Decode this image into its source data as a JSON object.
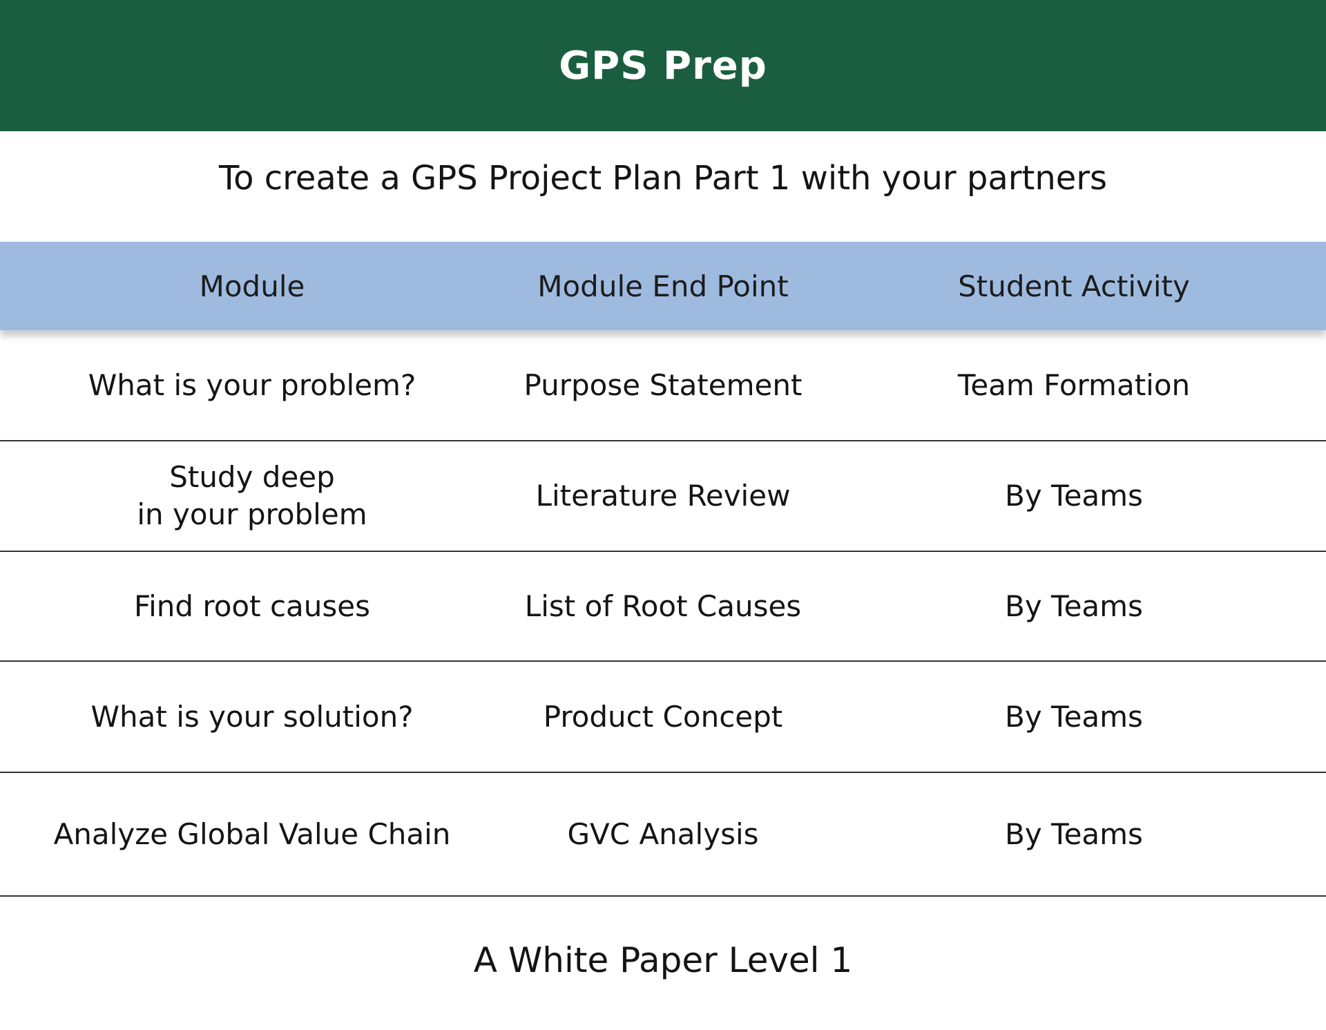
{
  "header": {
    "title": "GPS Prep",
    "color": "#1b5e3f"
  },
  "subtitle": "To create a GPS Project Plan Part 1 with your partners",
  "table": {
    "header_color": "#9ebbdf",
    "columns": [
      "Module",
      "Module End Point",
      "Student Activity"
    ],
    "rows": [
      [
        "What is your problem?",
        "Purpose Statement",
        "Team Formation"
      ],
      [
        "Study deep\nin your problem",
        "Literature Review",
        "By Teams"
      ],
      [
        "Find root causes",
        "List of Root Causes",
        "By Teams"
      ],
      [
        "What is your solution?",
        "Product Concept",
        "By Teams"
      ],
      [
        "Analyze Global Value Chain",
        "GVC Analysis",
        "By Teams"
      ]
    ]
  },
  "footer": "A White Paper Level 1"
}
